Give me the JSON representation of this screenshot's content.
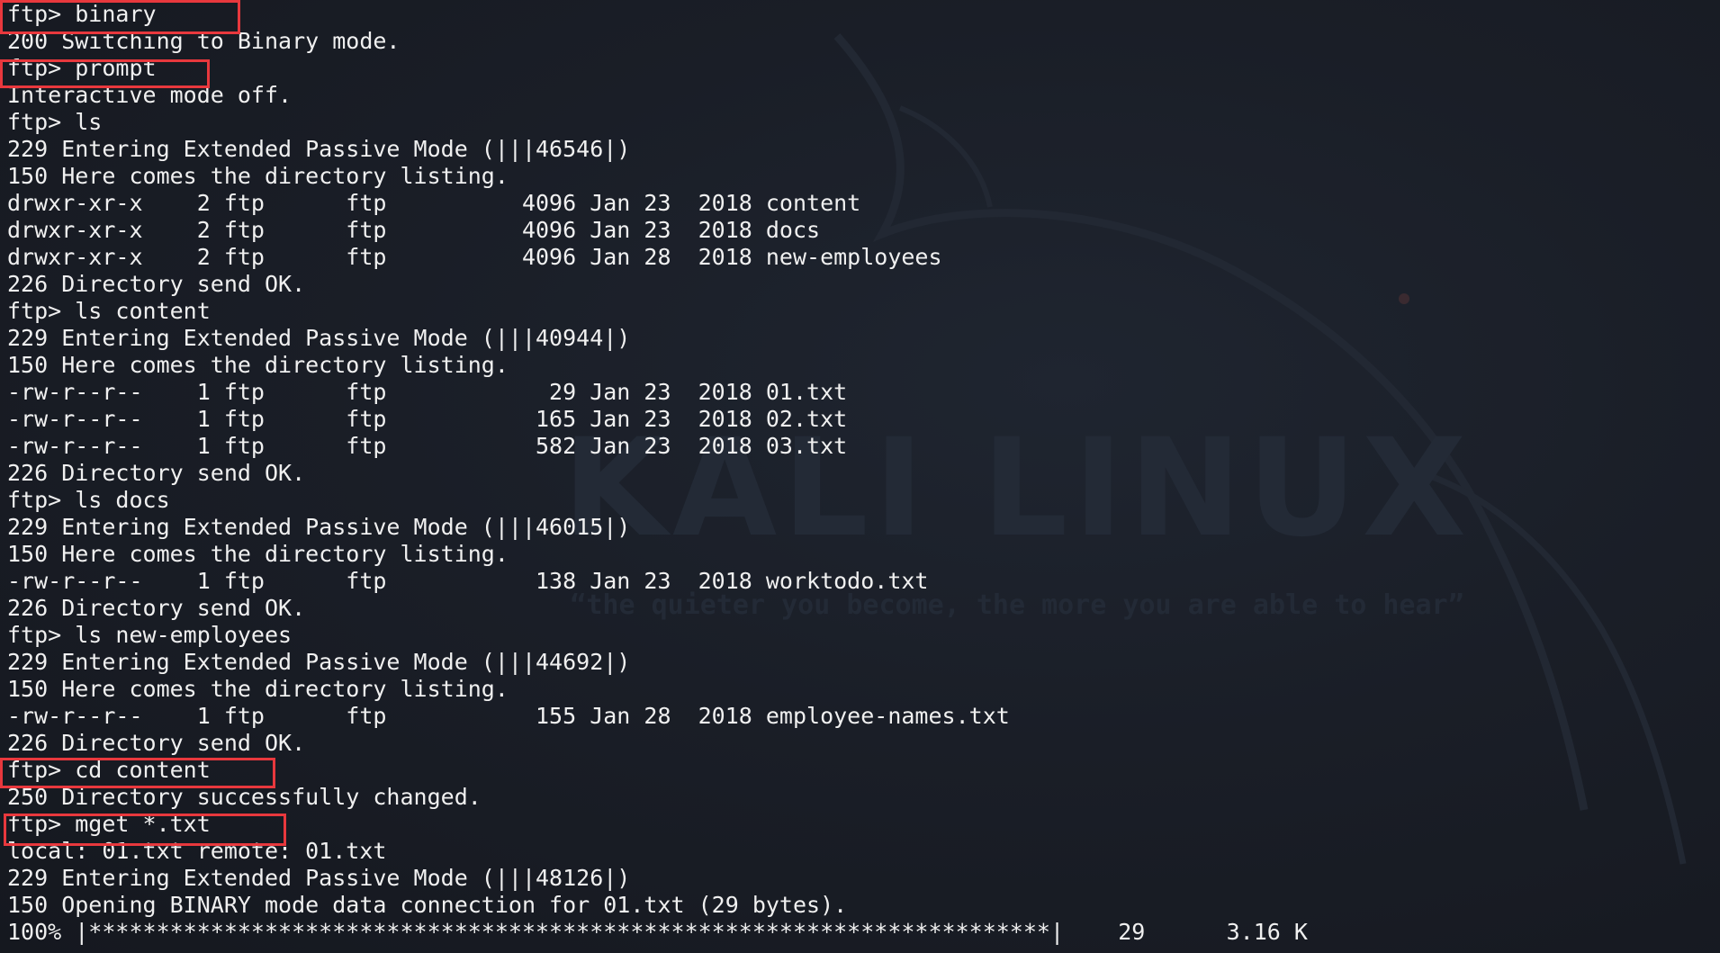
{
  "terminal": {
    "lines": [
      "ftp> binary",
      "200 Switching to Binary mode.",
      "ftp> prompt",
      "Interactive mode off.",
      "ftp> ls",
      "229 Entering Extended Passive Mode (|||46546|)",
      "150 Here comes the directory listing.",
      "drwxr-xr-x    2 ftp      ftp          4096 Jan 23  2018 content",
      "drwxr-xr-x    2 ftp      ftp          4096 Jan 23  2018 docs",
      "drwxr-xr-x    2 ftp      ftp          4096 Jan 28  2018 new-employees",
      "226 Directory send OK.",
      "ftp> ls content",
      "229 Entering Extended Passive Mode (|||40944|)",
      "150 Here comes the directory listing.",
      "-rw-r--r--    1 ftp      ftp            29 Jan 23  2018 01.txt",
      "-rw-r--r--    1 ftp      ftp           165 Jan 23  2018 02.txt",
      "-rw-r--r--    1 ftp      ftp           582 Jan 23  2018 03.txt",
      "226 Directory send OK.",
      "ftp> ls docs",
      "229 Entering Extended Passive Mode (|||46015|)",
      "150 Here comes the directory listing.",
      "-rw-r--r--    1 ftp      ftp           138 Jan 23  2018 worktodo.txt",
      "226 Directory send OK.",
      "ftp> ls new-employees",
      "229 Entering Extended Passive Mode (|||44692|)",
      "150 Here comes the directory listing.",
      "-rw-r--r--    1 ftp      ftp           155 Jan 28  2018 employee-names.txt",
      "226 Directory send OK.",
      "ftp> cd content",
      "250 Directory successfully changed.",
      "ftp> mget *.txt",
      "local: 01.txt remote: 01.txt",
      "229 Entering Extended Passive Mode (|||48126|)",
      "150 Opening BINARY mode data connection for 01.txt (29 bytes).",
      "100% |***********************************************************************|    29      3.16 K"
    ]
  },
  "wallpaper": {
    "logo_text": "KALI LINUX",
    "tagline": "“the quieter you become, the more you are able to hear”"
  },
  "colors": {
    "background": "#181c24",
    "text": "#f0f0f0",
    "highlight_box": "#e8383d"
  }
}
